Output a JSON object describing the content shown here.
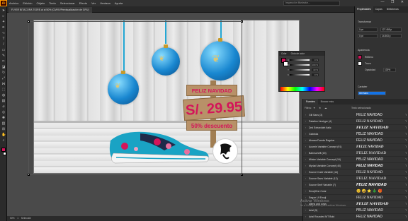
{
  "window": {
    "title": "FLYER BITACORA TIGRE.ai al 50% (CMYK/Previsualización de GPU)",
    "search_placeholder": "Inspección Illustrator..."
  },
  "menu": [
    "Archivo",
    "Edición",
    "Objeto",
    "Texto",
    "Seleccionar",
    "Efecto",
    "Ver",
    "Ventana",
    "Ayuda"
  ],
  "artwork": {
    "sign_line1": "FELIZ NAVIDAD",
    "sign_price": "S/. 29.95",
    "sign_discount": "50% descuento"
  },
  "properties": {
    "tabs": [
      "Propiedades",
      "Capas",
      "Bibliotecas"
    ],
    "section_transform": "Transformar",
    "section_appearance": "Apariencia",
    "x": "0 px",
    "y": "0 px",
    "w": "127.455 p",
    "h": "14.563 p",
    "fill_label": "Relleno",
    "stroke_label": "Trazo",
    "opacity_label": "Opacidad",
    "opacity_value": "100%",
    "char_label": "Carácter",
    "font_value": "Gill Sans",
    "define_label": "Definir familia de fuentes"
  },
  "swatches": {
    "tabs": [
      "Color",
      "Guía de color"
    ],
    "rows": [
      {
        "label": "C",
        "value": "0 %"
      },
      {
        "label": "M",
        "value": "100 %"
      },
      {
        "label": "Y",
        "value": "43 %"
      },
      {
        "label": "K",
        "value": "0 %"
      }
    ]
  },
  "fonts": {
    "tabs": [
      "Fuentes",
      "Buscar más"
    ],
    "filters_label": "Filtros:",
    "sample_label": "Texto seleccionado",
    "list": [
      {
        "name": "Gill Sans (3)",
        "sample": "FELIZ NAVIDAD"
      },
      {
        "name": "Palatino Linotype (4)",
        "sample": "FELIZ NAVIDAD"
      },
      {
        "name": "Zed Extraviolet Italic",
        "sample": "FELIZ NAVIDAD"
      },
      {
        "name": "Gabriola",
        "sample": "FELIZ NAVIDAD"
      },
      {
        "name": "Ahsara Fuente Regular",
        "sample": "FELIZ NAVIDAD"
      },
      {
        "name": "Acumin Variable Concept (91)",
        "sample": "FELIZ NAVIDAD"
      },
      {
        "name": "Bahnschrift (15)",
        "sample": "FELIZ NAVIDAD"
      },
      {
        "name": "Minion Variable Concept (16)",
        "sample": "FELIZ NAVIDAD"
      },
      {
        "name": "Myriad Variable Concept (40)",
        "sample": "FELIZ NAVIDAD"
      },
      {
        "name": "Source Code Variable (14)",
        "sample": "FELIZ NAVIDAD"
      },
      {
        "name": "Source Sans Variable (12)",
        "sample": "FELIZ NAVIDAD"
      },
      {
        "name": "Source Serif Variable (7)",
        "sample": "FELIZ NAVIDAD"
      },
      {
        "name": "EmojiOne Color",
        "sample": "😊 😀 ⭐ 🎄 🎁"
      },
      {
        "name": "Segoe UI Emoji",
        "sample": "FELIZ NAVIDAD"
      },
      {
        "name": "aliens and cows",
        "sample": "FELIZ NAVIDAD"
      },
      {
        "name": "Arial (5)",
        "sample": "FELIZ NAVIDAD"
      },
      {
        "name": "Arial Rounded MT Bold",
        "sample": "FELIZ NAVIDAD"
      }
    ]
  },
  "watermark": {
    "line1": "Activar Windows",
    "line2": "Ve a Configuración para activar Windows."
  },
  "status": {
    "zoom": "50%",
    "artboard": "1",
    "tool": "Selección"
  }
}
